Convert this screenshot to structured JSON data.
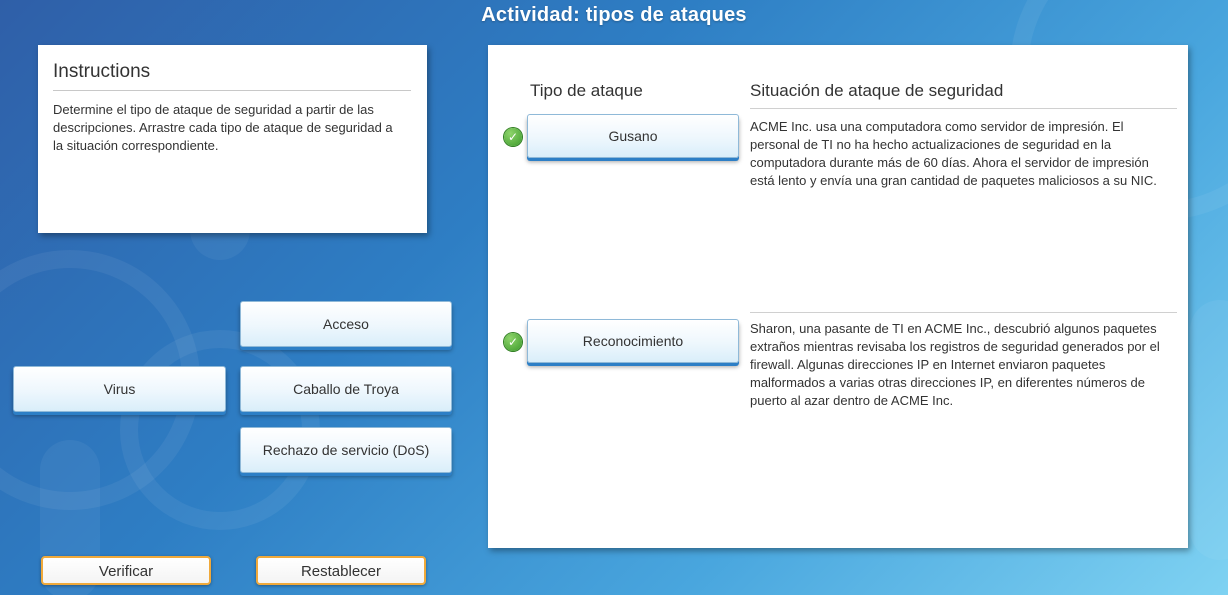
{
  "title": "Actividad: tipos de ataques",
  "instructions": {
    "heading": "Instructions",
    "text": "Determine el tipo de ataque de seguridad a partir de las descripciones. Arrastre cada tipo de ataque de seguridad a la situación correspondiente."
  },
  "table": {
    "col_type": "Tipo de ataque",
    "col_scenario": "Situación de ataque de seguridad",
    "rows": [
      {
        "answer": "Gusano",
        "correct": true,
        "scenario": "ACME Inc. usa una computadora como servidor de impresión. El personal de TI no ha hecho actualizaciones de seguridad en la computadora durante más de 60 días. Ahora el servidor de impresión está lento y envía una gran cantidad de paquetes maliciosos a su NIC."
      },
      {
        "answer": "Reconocimiento",
        "correct": true,
        "scenario": "Sharon, una pasante de TI en ACME Inc., descubrió algunos paquetes extraños mientras revisaba los registros de seguridad generados por el firewall. Algunas direcciones IP en Internet enviaron paquetes malformados a varias otras direcciones IP, en diferentes números de puerto al azar dentro de ACME Inc."
      }
    ]
  },
  "options": [
    "Acceso",
    "Virus",
    "Caballo de Troya",
    "Rechazo de servicio (DoS)"
  ],
  "buttons": {
    "verify": "Verificar",
    "reset": "Restablecer"
  },
  "colors": {
    "accent": "#2d7fc6",
    "button_border": "#f0a93a",
    "correct": "#3b9a2a"
  }
}
